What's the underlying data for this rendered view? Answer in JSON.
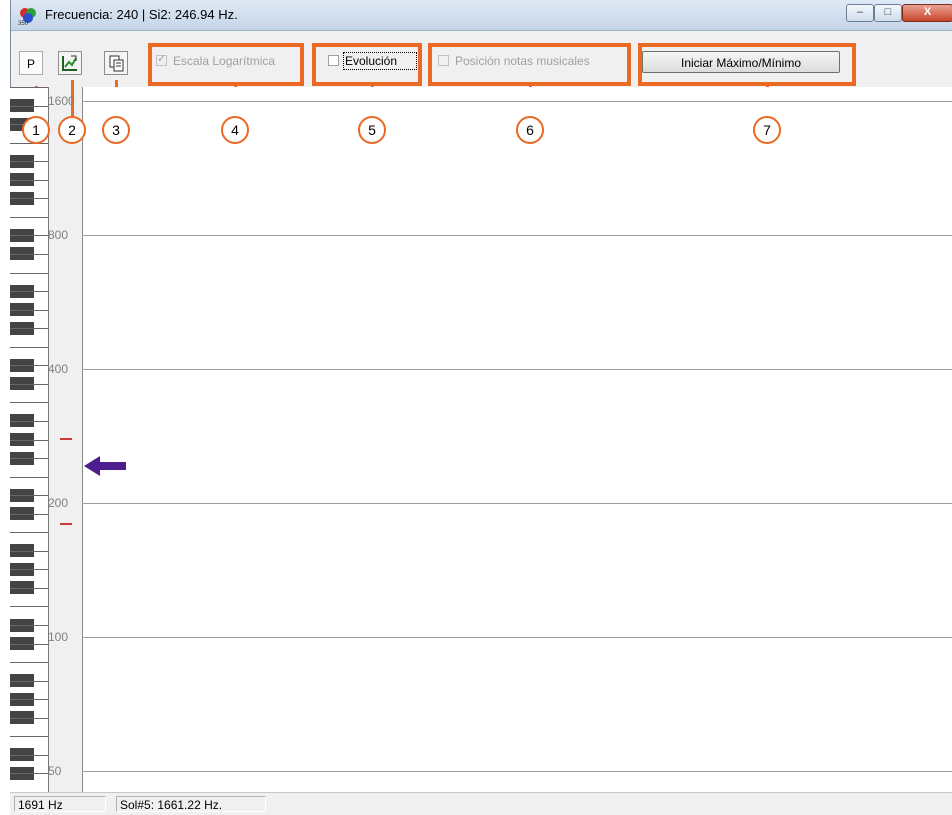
{
  "window": {
    "title": "Frecuencia: 240 | Si2: 246.94 Hz.",
    "app_icon": "color-circles-icon",
    "controls": {
      "minimize": "–",
      "maximize": "□",
      "close": "X"
    }
  },
  "toolbar": {
    "p_button": "P",
    "chart_icon": "chart-edit-icon",
    "copy_icon": "copy-icon",
    "log_scale": {
      "label": "Escala Logarítmica",
      "checked": true,
      "enabled": false
    },
    "evolution": {
      "label": "Evolución",
      "checked": false,
      "enabled": true
    },
    "note_positions": {
      "label": "Posición notas musicales",
      "checked": false,
      "enabled": false
    },
    "start_maxmin": "Iniciar Máximo/Mínimo"
  },
  "annotations": [
    "1",
    "2",
    "3",
    "4",
    "5",
    "6",
    "7"
  ],
  "annotation_color": "#ea6a23",
  "chart": {
    "y_scale": "log",
    "y_ticks": [
      "1600",
      "800",
      "400",
      "200",
      "100",
      "50"
    ],
    "current_frequency": 240,
    "arrow_color": "#4b1d8f",
    "tick_color": "#cc3a3a"
  },
  "status": {
    "max_freq": "1691  Hz",
    "note": "Sol#5: 1661.22 Hz."
  }
}
